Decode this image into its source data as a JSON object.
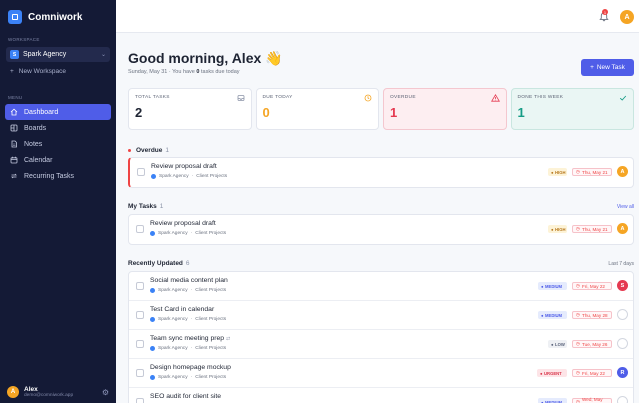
{
  "app": {
    "name": "Comniwork"
  },
  "sidebar": {
    "workspace_label": "WORKSPACE",
    "workspace": {
      "badge": "S",
      "name": "Spark Agency"
    },
    "new_workspace": "New Workspace",
    "menu_label": "MENU",
    "items": [
      {
        "label": "Dashboard",
        "icon": "home-icon",
        "active": true
      },
      {
        "label": "Boards",
        "icon": "board-icon"
      },
      {
        "label": "Notes",
        "icon": "note-icon"
      },
      {
        "label": "Calendar",
        "icon": "calendar-icon"
      },
      {
        "label": "Recurring Tasks",
        "icon": "repeat-icon"
      }
    ],
    "user": {
      "initial": "A",
      "name": "Alex",
      "email": "demo@comniwork.app"
    }
  },
  "topbar": {
    "notification_count": "1",
    "avatar_initial": "A"
  },
  "header": {
    "greeting": "Good morning, Alex 👋",
    "date": "Sunday, May 31",
    "subline_prefix": " · You have ",
    "due_count": "0",
    "subline_suffix": " tasks due today",
    "new_task_label": "New Task"
  },
  "stats": [
    {
      "label": "TOTAL TASKS",
      "value": "2",
      "color": "#1e2433",
      "icon": "inbox-icon"
    },
    {
      "label": "DUE TODAY",
      "value": "0",
      "color": "#f5a524",
      "icon": "clock-icon"
    },
    {
      "label": "OVERDUE",
      "value": "1",
      "color": "#e53950",
      "icon": "warning-icon"
    },
    {
      "label": "DONE THIS WEEK",
      "value": "1",
      "color": "#169c86",
      "icon": "check-icon"
    }
  ],
  "overdue": {
    "title": "Overdue",
    "count": "1",
    "tasks": [
      {
        "title": "Review proposal draft",
        "workspace": "Spark Agency",
        "board": "Client Projects",
        "priority": "HIGH",
        "due": "Thu, May 21",
        "avatar": "A",
        "avatar_color": "#f5a524"
      }
    ]
  },
  "my_tasks": {
    "title": "My Tasks",
    "count": "1",
    "link": "View all",
    "tasks": [
      {
        "title": "Review proposal draft",
        "workspace": "Spark Agency",
        "board": "Client Projects",
        "priority": "HIGH",
        "due": "Thu, May 21",
        "avatar": "A",
        "avatar_color": "#f5a524"
      }
    ]
  },
  "recent": {
    "title": "Recently Updated",
    "count": "6",
    "range": "Last 7 days",
    "tasks": [
      {
        "title": "Social media content plan",
        "workspace": "Spark Agency",
        "board": "Client Projects",
        "priority": "MEDIUM",
        "due": "Fri, May 22",
        "avatar": "S",
        "avatar_color": "#e53950"
      },
      {
        "title": "Test Card in calendar",
        "workspace": "Spark Agency",
        "board": "Client Projects",
        "priority": "MEDIUM",
        "due": "Thu, May 28",
        "avatar": "",
        "avatar_color": ""
      },
      {
        "title": "Team sync meeting prep",
        "workspace": "Spark Agency",
        "board": "Client Projects",
        "priority": "LOW",
        "due": "Tue, May 26",
        "avatar": "",
        "avatar_color": "",
        "recurring": true
      },
      {
        "title": "Design homepage mockup",
        "workspace": "Spark Agency",
        "board": "Client Projects",
        "priority": "URGENT",
        "due": "Fri, May 22",
        "avatar": "R",
        "avatar_color": "#4f5de8"
      },
      {
        "title": "SEO audit for client site",
        "workspace": "Spark Agency",
        "board": "Client Projects",
        "priority": "MEDIUM",
        "due": "Wed, May 27",
        "avatar": "",
        "avatar_color": ""
      }
    ]
  }
}
